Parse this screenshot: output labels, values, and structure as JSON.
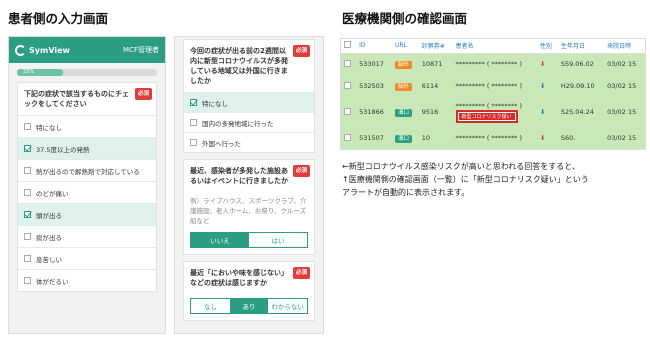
{
  "headings": {
    "left": "患者側の入力画面",
    "right": "医療機関側の確認画面"
  },
  "app": {
    "logo": "SymView",
    "user": "MCF管理者",
    "progress_label": "33%",
    "progress": 0.33
  },
  "required": "必須",
  "symptoms": {
    "question": "下記の症状で該当するものにチェックをしてください",
    "options": [
      {
        "label": "特になし",
        "checked": false
      },
      {
        "label": "37.5度以上の発熱",
        "checked": true
      },
      {
        "label": "熱が出るので解熱剤で対応している",
        "checked": false
      },
      {
        "label": "のどが痛い",
        "checked": false
      },
      {
        "label": "頭が出る",
        "checked": true
      },
      {
        "label": "痰が出る",
        "checked": false
      },
      {
        "label": "息苦しい",
        "checked": false
      },
      {
        "label": "体がだるい",
        "checked": false
      }
    ]
  },
  "travel": {
    "question": "今回の症状が出る前の2週間以内に新型コロナウイルスが多発している地域又は外国に行きましたか",
    "options": [
      {
        "label": "特になし",
        "checked": true
      },
      {
        "label": "国内の多発地域に行った",
        "checked": false
      },
      {
        "label": "外国へ行った",
        "checked": false
      }
    ]
  },
  "crowd": {
    "question": "最近、感染者が多発した施設あるいはイベントに行きましたか",
    "hint": "例）ライブハウス、スポーツクラブ、介護施設、老人ホーム、お祭り、クルーズ船など",
    "choices": [
      "いいえ",
      "はい"
    ],
    "selected": 0
  },
  "smell": {
    "question": "最近「においや味を感じない」などの症状は感じますか",
    "choices": [
      "なし",
      "あり",
      "わからない"
    ],
    "selected": 1
  },
  "table": {
    "headers": [
      "ID",
      "URL",
      "診察券#",
      "患者名",
      "性別",
      "生年月日",
      "来院日時"
    ],
    "rows": [
      {
        "id": "533017",
        "url": "脳外",
        "url_color": "#f08a24",
        "card": "10871",
        "name": "********* ( ******** )",
        "sex": "F",
        "dob": "S59.06.02",
        "visit": "03/02 15",
        "alert": ""
      },
      {
        "id": "532503",
        "url": "脳外",
        "url_color": "#f08a24",
        "card": "6114",
        "name": "********* ( ******** )",
        "sex": "M",
        "dob": "H29.09.10",
        "visit": "03/02 15",
        "alert": ""
      },
      {
        "id": "531866",
        "url": "溝口",
        "url_color": "#2a9d83",
        "card": "9516",
        "name": "********* ( ******** )",
        "sex": "M",
        "dob": "S25.04.24",
        "visit": "03/02 15",
        "alert": "新型コロナリスク疑い"
      },
      {
        "id": "531507",
        "url": "溝口",
        "url_color": "#2a9d83",
        "card": "10",
        "name": "********* ( ******** )",
        "sex": "F",
        "dob": "S60.",
        "visit": "03/02 15",
        "alert": ""
      }
    ]
  },
  "note": {
    "line1": "←新型コロナウイルス感染リスクが高いと思われる回答をすると、",
    "line2": "↑医療機関側の確認画面（一覧）に「新型コロナリスク疑い」という",
    "line3": "アラートが自動的に表示されます。"
  },
  "colors": {
    "accent": "#2a9d83",
    "alert": "#d42a2a",
    "row_bg": "#c8e8b8"
  }
}
